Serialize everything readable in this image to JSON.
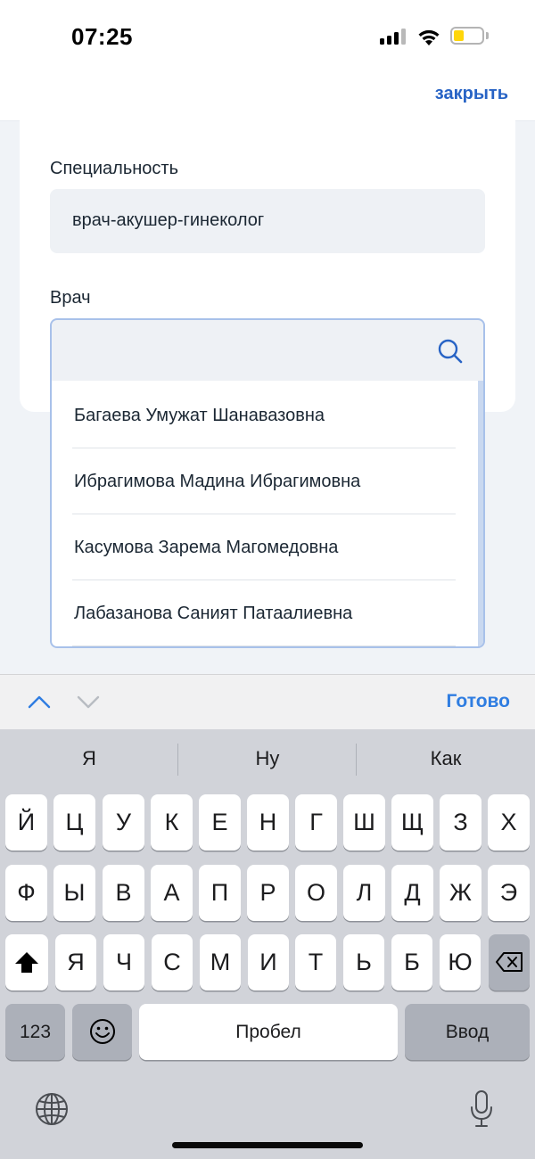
{
  "status": {
    "time": "07:25"
  },
  "header": {
    "close_label": "закрыть"
  },
  "form": {
    "specialty_label": "Специальность",
    "specialty_value": "врач-акушер-гинеколог",
    "doctor_label": "Врач",
    "doctor_value": ""
  },
  "dropdown": {
    "options": [
      "Багаева Умужат Шанавазовна",
      "Ибрагимова Мадина Ибрагимовна",
      "Касумова Зарема Магомедовна",
      "Лабазанова Саният Патаалиевна"
    ]
  },
  "keyboard_toolbar": {
    "done_label": "Готово"
  },
  "keyboard": {
    "suggestions": [
      "Я",
      "Ну",
      "Как"
    ],
    "row1": [
      "Й",
      "Ц",
      "У",
      "К",
      "Е",
      "Н",
      "Г",
      "Ш",
      "Щ",
      "З",
      "Х"
    ],
    "row2": [
      "Ф",
      "Ы",
      "В",
      "А",
      "П",
      "Р",
      "О",
      "Л",
      "Д",
      "Ж",
      "Э"
    ],
    "row3": [
      "Я",
      "Ч",
      "С",
      "М",
      "И",
      "Т",
      "Ь",
      "Б",
      "Ю"
    ],
    "numbers_label": "123",
    "space_label": "Пробел",
    "return_label": "Ввод"
  },
  "icons": {
    "search": "search-icon",
    "chevron_up": "chevron-up-icon",
    "chevron_down": "chevron-down-icon",
    "shift": "shift-icon",
    "backspace": "backspace-icon",
    "emoji": "emoji-icon",
    "globe": "globe-icon",
    "microphone": "microphone-icon"
  },
  "colors": {
    "accent": "#2763c5",
    "done": "#2f7de1",
    "battery": "#ffd60a",
    "input_border": "#a8c1ea"
  }
}
